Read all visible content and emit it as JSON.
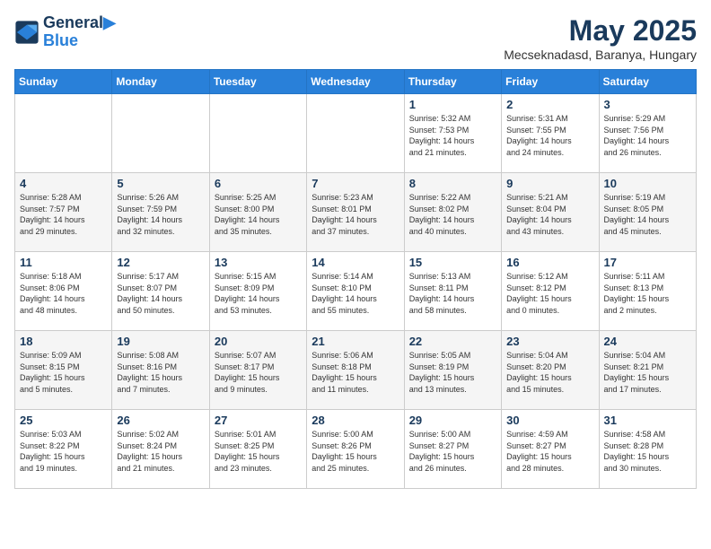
{
  "logo": {
    "line1": "General",
    "line2": "Blue"
  },
  "title": "May 2025",
  "location": "Mecseknadasd, Baranya, Hungary",
  "weekdays": [
    "Sunday",
    "Monday",
    "Tuesday",
    "Wednesday",
    "Thursday",
    "Friday",
    "Saturday"
  ],
  "weeks": [
    [
      {
        "day": "",
        "info": ""
      },
      {
        "day": "",
        "info": ""
      },
      {
        "day": "",
        "info": ""
      },
      {
        "day": "",
        "info": ""
      },
      {
        "day": "1",
        "info": "Sunrise: 5:32 AM\nSunset: 7:53 PM\nDaylight: 14 hours\nand 21 minutes."
      },
      {
        "day": "2",
        "info": "Sunrise: 5:31 AM\nSunset: 7:55 PM\nDaylight: 14 hours\nand 24 minutes."
      },
      {
        "day": "3",
        "info": "Sunrise: 5:29 AM\nSunset: 7:56 PM\nDaylight: 14 hours\nand 26 minutes."
      }
    ],
    [
      {
        "day": "4",
        "info": "Sunrise: 5:28 AM\nSunset: 7:57 PM\nDaylight: 14 hours\nand 29 minutes."
      },
      {
        "day": "5",
        "info": "Sunrise: 5:26 AM\nSunset: 7:59 PM\nDaylight: 14 hours\nand 32 minutes."
      },
      {
        "day": "6",
        "info": "Sunrise: 5:25 AM\nSunset: 8:00 PM\nDaylight: 14 hours\nand 35 minutes."
      },
      {
        "day": "7",
        "info": "Sunrise: 5:23 AM\nSunset: 8:01 PM\nDaylight: 14 hours\nand 37 minutes."
      },
      {
        "day": "8",
        "info": "Sunrise: 5:22 AM\nSunset: 8:02 PM\nDaylight: 14 hours\nand 40 minutes."
      },
      {
        "day": "9",
        "info": "Sunrise: 5:21 AM\nSunset: 8:04 PM\nDaylight: 14 hours\nand 43 minutes."
      },
      {
        "day": "10",
        "info": "Sunrise: 5:19 AM\nSunset: 8:05 PM\nDaylight: 14 hours\nand 45 minutes."
      }
    ],
    [
      {
        "day": "11",
        "info": "Sunrise: 5:18 AM\nSunset: 8:06 PM\nDaylight: 14 hours\nand 48 minutes."
      },
      {
        "day": "12",
        "info": "Sunrise: 5:17 AM\nSunset: 8:07 PM\nDaylight: 14 hours\nand 50 minutes."
      },
      {
        "day": "13",
        "info": "Sunrise: 5:15 AM\nSunset: 8:09 PM\nDaylight: 14 hours\nand 53 minutes."
      },
      {
        "day": "14",
        "info": "Sunrise: 5:14 AM\nSunset: 8:10 PM\nDaylight: 14 hours\nand 55 minutes."
      },
      {
        "day": "15",
        "info": "Sunrise: 5:13 AM\nSunset: 8:11 PM\nDaylight: 14 hours\nand 58 minutes."
      },
      {
        "day": "16",
        "info": "Sunrise: 5:12 AM\nSunset: 8:12 PM\nDaylight: 15 hours\nand 0 minutes."
      },
      {
        "day": "17",
        "info": "Sunrise: 5:11 AM\nSunset: 8:13 PM\nDaylight: 15 hours\nand 2 minutes."
      }
    ],
    [
      {
        "day": "18",
        "info": "Sunrise: 5:09 AM\nSunset: 8:15 PM\nDaylight: 15 hours\nand 5 minutes."
      },
      {
        "day": "19",
        "info": "Sunrise: 5:08 AM\nSunset: 8:16 PM\nDaylight: 15 hours\nand 7 minutes."
      },
      {
        "day": "20",
        "info": "Sunrise: 5:07 AM\nSunset: 8:17 PM\nDaylight: 15 hours\nand 9 minutes."
      },
      {
        "day": "21",
        "info": "Sunrise: 5:06 AM\nSunset: 8:18 PM\nDaylight: 15 hours\nand 11 minutes."
      },
      {
        "day": "22",
        "info": "Sunrise: 5:05 AM\nSunset: 8:19 PM\nDaylight: 15 hours\nand 13 minutes."
      },
      {
        "day": "23",
        "info": "Sunrise: 5:04 AM\nSunset: 8:20 PM\nDaylight: 15 hours\nand 15 minutes."
      },
      {
        "day": "24",
        "info": "Sunrise: 5:04 AM\nSunset: 8:21 PM\nDaylight: 15 hours\nand 17 minutes."
      }
    ],
    [
      {
        "day": "25",
        "info": "Sunrise: 5:03 AM\nSunset: 8:22 PM\nDaylight: 15 hours\nand 19 minutes."
      },
      {
        "day": "26",
        "info": "Sunrise: 5:02 AM\nSunset: 8:24 PM\nDaylight: 15 hours\nand 21 minutes."
      },
      {
        "day": "27",
        "info": "Sunrise: 5:01 AM\nSunset: 8:25 PM\nDaylight: 15 hours\nand 23 minutes."
      },
      {
        "day": "28",
        "info": "Sunrise: 5:00 AM\nSunset: 8:26 PM\nDaylight: 15 hours\nand 25 minutes."
      },
      {
        "day": "29",
        "info": "Sunrise: 5:00 AM\nSunset: 8:27 PM\nDaylight: 15 hours\nand 26 minutes."
      },
      {
        "day": "30",
        "info": "Sunrise: 4:59 AM\nSunset: 8:27 PM\nDaylight: 15 hours\nand 28 minutes."
      },
      {
        "day": "31",
        "info": "Sunrise: 4:58 AM\nSunset: 8:28 PM\nDaylight: 15 hours\nand 30 minutes."
      }
    ]
  ]
}
